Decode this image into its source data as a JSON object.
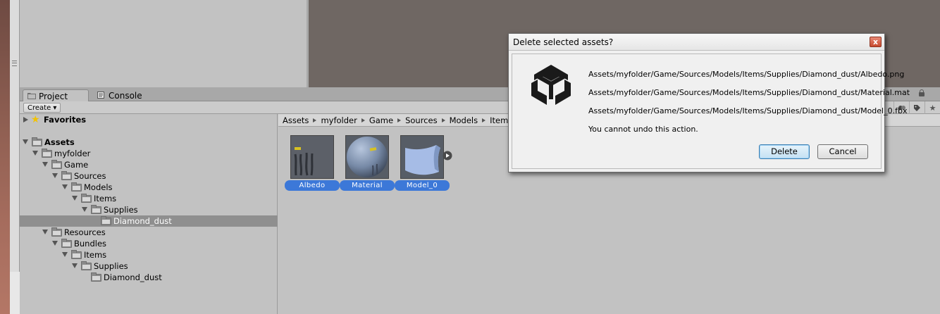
{
  "tabs": [
    {
      "label": "Project",
      "active": true
    },
    {
      "label": "Console",
      "active": false
    }
  ],
  "toolbar": {
    "create_label": "Create ▾"
  },
  "tree": [
    {
      "label": "Favorites",
      "depth": 0,
      "expanded": false,
      "kind": "favorites",
      "bold": true
    },
    {
      "label": "Assets",
      "depth": 0,
      "expanded": true,
      "kind": "folder",
      "bold": true
    },
    {
      "label": "myfolder",
      "depth": 1,
      "expanded": true,
      "kind": "folder"
    },
    {
      "label": "Game",
      "depth": 2,
      "expanded": true,
      "kind": "folder"
    },
    {
      "label": "Sources",
      "depth": 3,
      "expanded": true,
      "kind": "folder"
    },
    {
      "label": "Models",
      "depth": 4,
      "expanded": true,
      "kind": "folder"
    },
    {
      "label": "Items",
      "depth": 5,
      "expanded": true,
      "kind": "folder"
    },
    {
      "label": "Supplies",
      "depth": 6,
      "expanded": true,
      "kind": "folder"
    },
    {
      "label": "Diamond_dust",
      "depth": 7,
      "expanded": null,
      "kind": "folder",
      "selected": true
    },
    {
      "label": "Resources",
      "depth": 1,
      "expanded": true,
      "kind": "folder"
    },
    {
      "label": "Bundles",
      "depth": 2,
      "expanded": true,
      "kind": "folder"
    },
    {
      "label": "Items",
      "depth": 3,
      "expanded": true,
      "kind": "folder"
    },
    {
      "label": "Supplies",
      "depth": 4,
      "expanded": true,
      "kind": "folder"
    },
    {
      "label": "Diamond_dust",
      "depth": 5,
      "expanded": null,
      "kind": "folder"
    }
  ],
  "breadcrumb": [
    "Assets",
    "myfolder",
    "Game",
    "Sources",
    "Models",
    "Items"
  ],
  "assets": [
    {
      "label": "Albedo",
      "kind": "texture"
    },
    {
      "label": "Material",
      "kind": "material"
    },
    {
      "label": "Model_0",
      "kind": "model"
    }
  ],
  "dialog": {
    "title": "Delete selected assets?",
    "close_label": "x",
    "lines": [
      "Assets/myfolder/Game/Sources/Models/Items/Supplies/Diamond_dust/Albedo.png",
      "Assets/myfolder/Game/Sources/Models/Items/Supplies/Diamond_dust/Material.mat",
      "Assets/myfolder/Game/Sources/Models/Items/Supplies/Diamond_dust/Model_0.fbx"
    ],
    "warning": "You cannot undo this action.",
    "delete_label": "Delete",
    "cancel_label": "Cancel"
  },
  "colors": {
    "selection": "#3c78d8",
    "scene_bg": "#6f6763",
    "panel_bg": "#c2c2c2"
  }
}
